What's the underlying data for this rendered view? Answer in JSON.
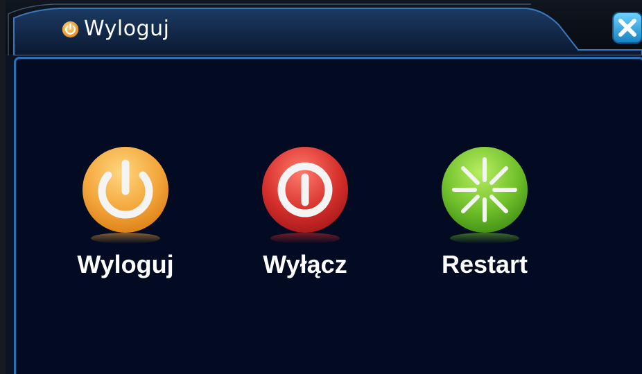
{
  "window": {
    "title": "Wyloguj",
    "title_icon": "power-icon",
    "close_icon": "close-icon"
  },
  "actions": [
    {
      "label": "Wyloguj",
      "icon": "power-icon",
      "color": "#f0a23a"
    },
    {
      "label": "Wyłącz",
      "icon": "shutdown-icon",
      "color": "#d42a2a"
    },
    {
      "label": "Restart",
      "icon": "restart-icon",
      "color": "#6fbf2a"
    }
  ],
  "colors": {
    "background": "#020b22",
    "border": "#2f6fb4",
    "close_button": "#2aa7e0",
    "text": "#ffffff"
  }
}
